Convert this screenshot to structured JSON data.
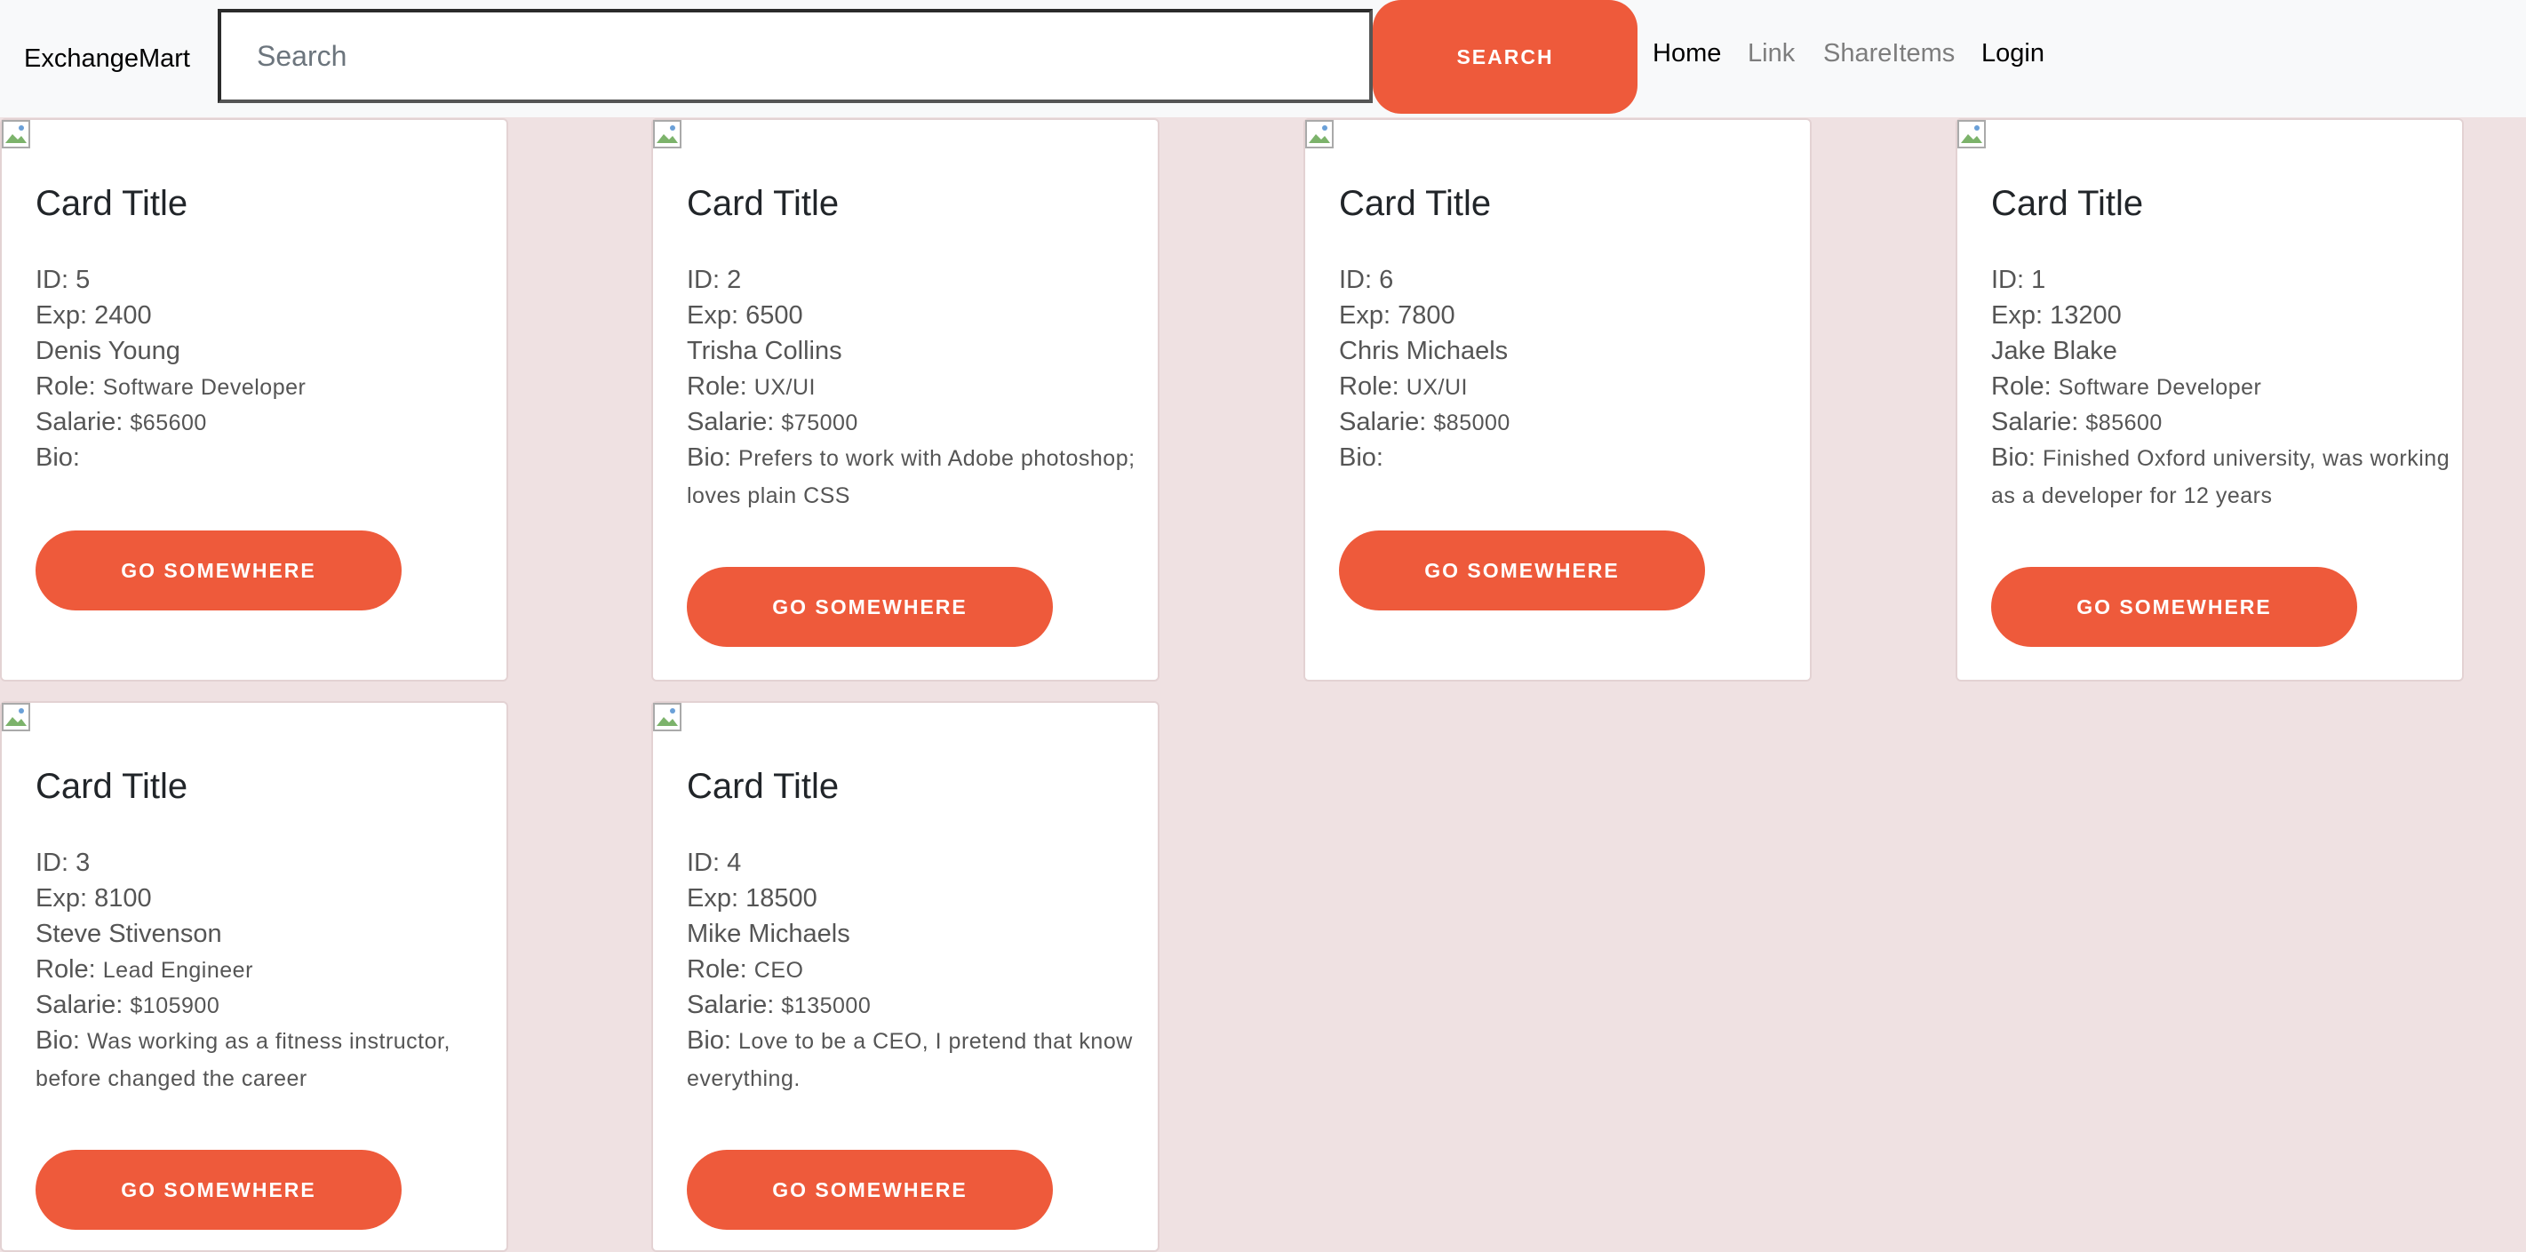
{
  "navbar": {
    "brand": "ExchangeMart",
    "search_placeholder": "Search",
    "search_button": "SEARCH",
    "links": [
      "Home",
      "Link",
      "ShareItems",
      "Login"
    ]
  },
  "labels": {
    "id": "ID: ",
    "exp": "Exp: ",
    "role": "Role: ",
    "salary": "Salarie: ",
    "bio": "Bio: "
  },
  "cards": [
    {
      "title": "Card Title",
      "id": "5",
      "exp": "2400",
      "name": "Denis Young",
      "role": "Software Developer",
      "salary": "$65600",
      "bio": "",
      "button": "GO SOMEWHERE"
    },
    {
      "title": "Card Title",
      "id": "2",
      "exp": "6500",
      "name": "Trisha Collins",
      "role": "UX/UI",
      "salary": "$75000",
      "bio": "Prefers to work with Adobe photoshop; loves plain CSS",
      "button": "GO SOMEWHERE"
    },
    {
      "title": "Card Title",
      "id": "6",
      "exp": "7800",
      "name": "Chris Michaels",
      "role": "UX/UI",
      "salary": "$85000",
      "bio": "",
      "button": "GO SOMEWHERE"
    },
    {
      "title": "Card Title",
      "id": "1",
      "exp": "13200",
      "name": "Jake Blake",
      "role": "Software Developer",
      "salary": "$85600",
      "bio": "Finished Oxford university, was working as a developer for 12 years",
      "button": "GO SOMEWHERE"
    },
    {
      "title": "Card Title",
      "id": "3",
      "exp": "8100",
      "name": "Steve Stivenson",
      "role": "Lead Engineer",
      "salary": "$105900",
      "bio": "Was working as a fitness instructor, before changed the career",
      "button": "GO SOMEWHERE"
    },
    {
      "title": "Card Title",
      "id": "4",
      "exp": "18500",
      "name": "Mike Michaels",
      "role": "CEO",
      "salary": "$135000",
      "bio": "Love to be a CEO, I pretend that know everything.",
      "button": "GO SOMEWHERE"
    }
  ]
}
